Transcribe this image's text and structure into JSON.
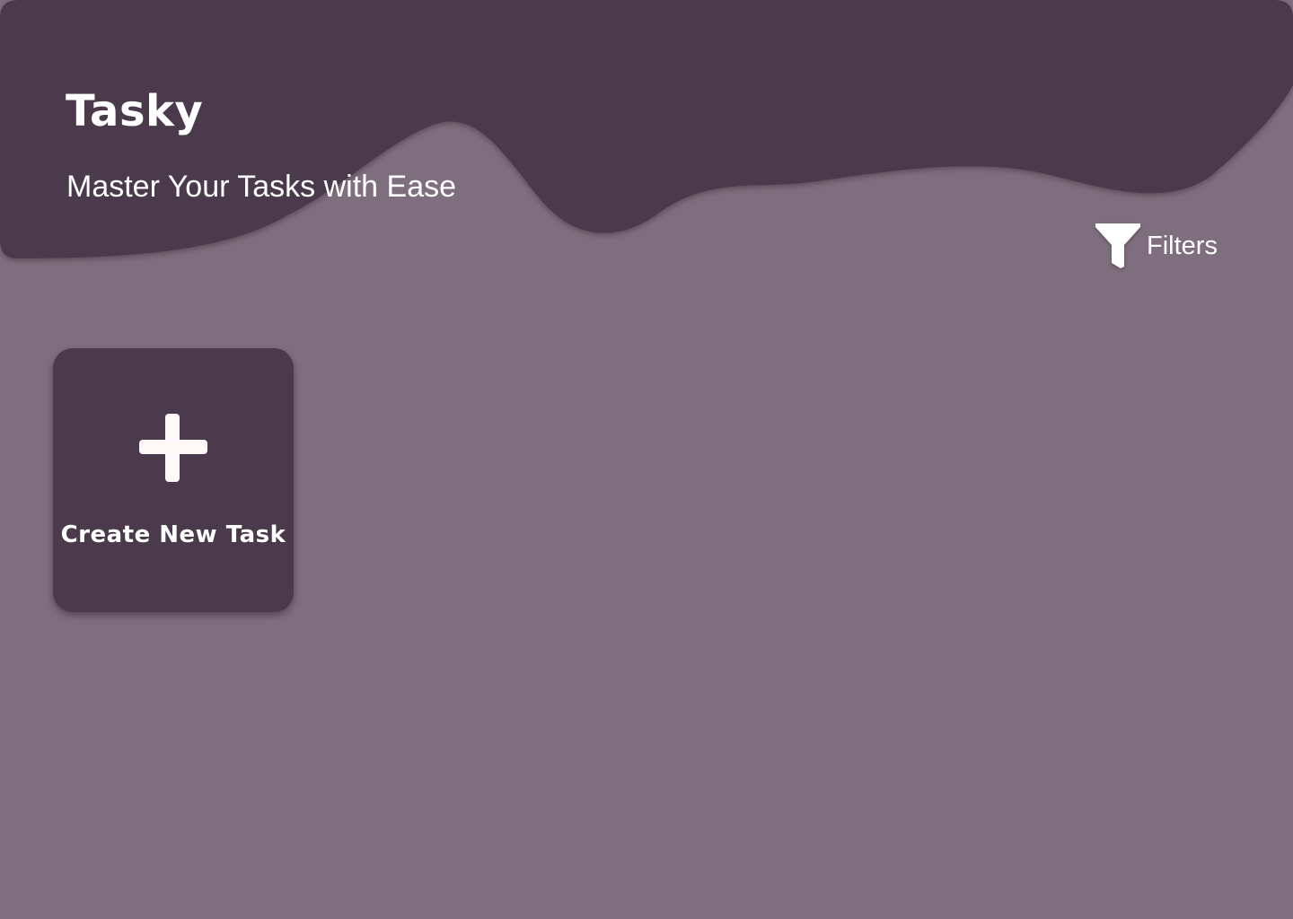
{
  "app": {
    "title": "Tasky",
    "subtitle": "Master Your Tasks with Ease"
  },
  "toolbar": {
    "filters_label": "Filters",
    "filters_icon": "filter-icon"
  },
  "create_card": {
    "label": "Create New Task",
    "icon": "plus-icon"
  },
  "colors": {
    "background": "#7f6f7e",
    "header": "#4a3a4b",
    "card": "#4a3a4b",
    "text": "#ffffff"
  }
}
